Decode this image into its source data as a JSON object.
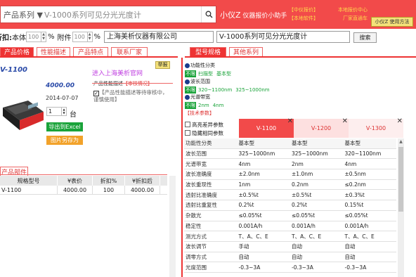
{
  "header": {
    "category": "产品系列 ▼",
    "search_value": "V-1000系列可见分光光度计",
    "brand_name": "小仪Z",
    "brand_sub": "仪器报价小助手",
    "links": [
      "【中仪报价】",
      "本地报价中心",
      "【本地软件】",
      "厂家直通车"
    ],
    "help_button": "小仪Z 使用方法"
  },
  "discount": {
    "label": "折扣:",
    "main_label": "本体",
    "main_value": "100",
    "percent": "%",
    "accessory_label": "附件",
    "accessory_value": "100",
    "company": "上海美析仪器有限公司",
    "model_search": "V-1000系列可见分光光度计",
    "search_button": "搜索"
  },
  "left_tabs": [
    "产品价格",
    "性能描述",
    "产品特点",
    "联系厂家"
  ],
  "right_tabs": [
    "型号规格",
    "其他系列"
  ],
  "product": {
    "model": "V-1100",
    "report": "举报",
    "price": "4000.00",
    "date": "2014-07-07",
    "site_link": "进入上海美析官网",
    "desc_title": "产品性能描述",
    "desc_tag": "【审核情况】",
    "desc_body": "【产品性能描述等待审核中，谨慎使用】",
    "qty": "1",
    "unit": "台",
    "export_button": "导出到Excel",
    "save_image_button": "图片另存为"
  },
  "parts": {
    "title": "产品部件",
    "headers": [
      "规格型号",
      "¥表价",
      "折扣%",
      "¥折扣后"
    ],
    "rows": [
      [
        "V-1100",
        "4000.00",
        "100",
        "4000.00"
      ]
    ]
  },
  "filters": [
    {
      "label": "功能性分类",
      "options": [
        "不限",
        "扫描型",
        "基本型"
      ]
    },
    {
      "label": "波长范围",
      "options": [
        "不限",
        "320~1100nm",
        "325~1000nm"
      ]
    },
    {
      "label": "光谱带宽",
      "options": [
        "不限",
        "2nm",
        "4nm"
      ]
    }
  ],
  "tech_title": "【技术参数】",
  "compare": {
    "highlight_label": "高亮差异参数",
    "hide_label": "隐藏相同参数",
    "columns": [
      "V-1100",
      "V-1200",
      "V-1300"
    ],
    "column_colors": [
      "#f24a4a",
      "#fde0e0",
      "#fdeeee"
    ]
  },
  "specs": [
    [
      "功能性分类",
      "基本型",
      "基本型",
      "基本型"
    ],
    [
      "波长范围",
      "325~1000nm",
      "325~1000nm",
      "320~1100nm"
    ],
    [
      "光谱带宽",
      "4nm",
      "2nm",
      "4nm"
    ],
    [
      "波长准确度",
      "±2.0nm",
      "±1.0nm",
      "±0.5nm"
    ],
    [
      "波长重现性",
      "1nm",
      "0.2nm",
      "≤0.2nm"
    ],
    [
      "透射比准确度",
      "±0.5%t",
      "±0.5%t",
      "±0.3%t"
    ],
    [
      "透射比重复性",
      "0.2%t",
      "0.2%t",
      "0.15%t"
    ],
    [
      "杂散光",
      "≤0.05%t",
      "≤0.05%t",
      "≤0.05%t"
    ],
    [
      "稳定性",
      "0.001A/h",
      "0.001A/h",
      "0.001A/h"
    ],
    [
      "测光方式",
      "T、A、C、E",
      "T、A、C、E",
      "T、A、C、E"
    ],
    [
      "波长调节",
      "手动",
      "自动",
      "自动"
    ],
    [
      "调零方式",
      "自动",
      "自动",
      "自动"
    ],
    [
      "光度范围",
      "-0.3~3A",
      "-0.3~3A",
      "-0.3~3A"
    ]
  ]
}
